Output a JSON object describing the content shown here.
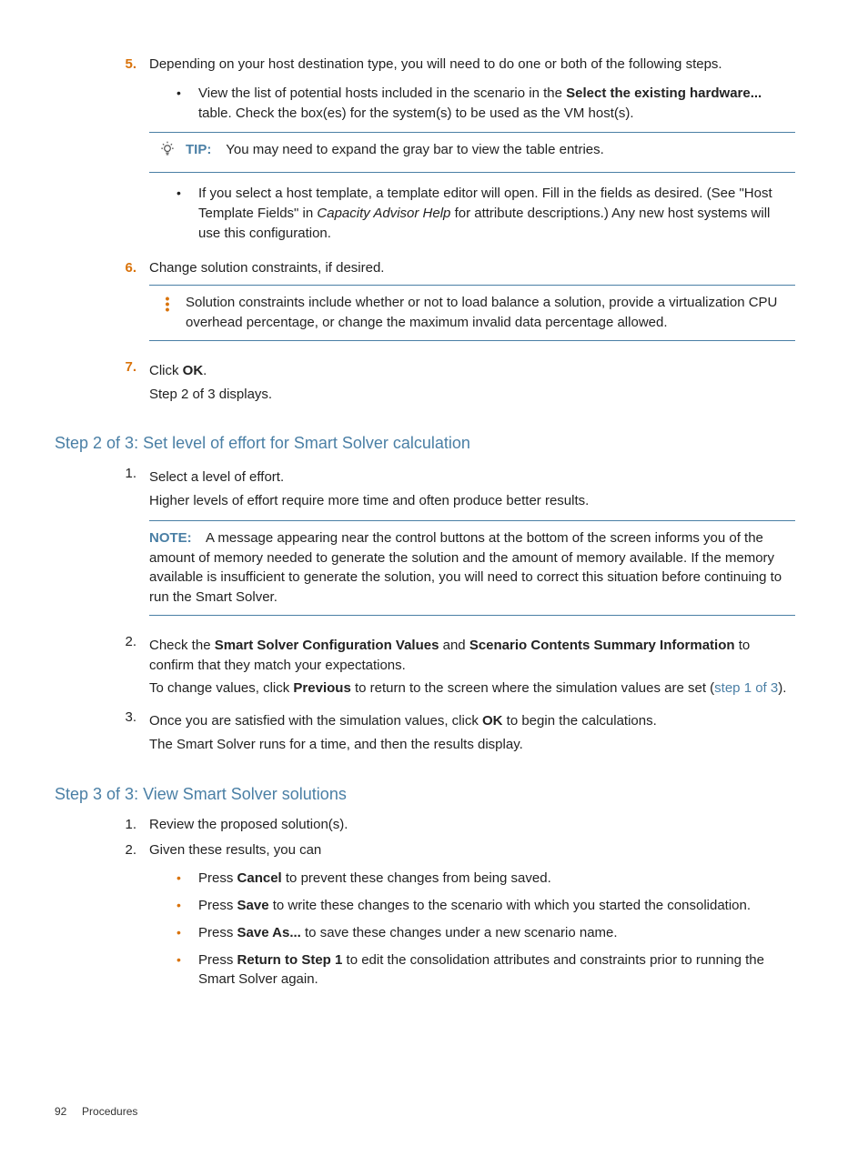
{
  "section1": {
    "item5": {
      "num": "5.",
      "text": "Depending on your host destination type, you will need to do one or both of the following steps.",
      "bullet1a": "View the list of potential hosts included in the scenario in the ",
      "bullet1b": "Select the existing hardware...",
      "bullet1c": " table. Check the box(es) for the system(s) to be used as the VM host(s).",
      "tipLabel": "TIP:",
      "tipText": "You may need to expand the gray bar to view the table entries.",
      "bullet2a": "If you select a host template, a template editor will open. Fill in the fields as desired. (See \"Host Template Fields\" in ",
      "bullet2b": "Capacity Advisor Help",
      "bullet2c": " for attribute descriptions.) Any new host systems will use this configuration."
    },
    "item6": {
      "num": "6.",
      "text": "Change solution constraints, if desired.",
      "noteText": "Solution constraints include whether or not to load balance a solution, provide a virtualization CPU overhead percentage, or change the maximum invalid data percentage allowed."
    },
    "item7": {
      "num": "7.",
      "textA": "Click ",
      "textB": "OK",
      "textC": ".",
      "sub": "Step 2 of 3 displays."
    }
  },
  "heading2": "Step 2 of 3: Set level of effort for Smart Solver calculation",
  "section2": {
    "item1": {
      "num": "1.",
      "text": "Select a level of effort.",
      "sub": "Higher levels of effort require more time and often produce better results.",
      "noteLabel": "NOTE:",
      "noteText": "A message appearing near the control buttons at the bottom of the screen informs you of the amount of memory needed to generate the solution and the amount of memory available. If the memory available is insufficient to generate the solution, you will need to correct this situation before continuing to run the Smart Solver."
    },
    "item2": {
      "num": "2.",
      "a": "Check the ",
      "b": "Smart Solver Configuration Values",
      "c": " and ",
      "d": "Scenario Contents Summary Information",
      "e": " to confirm that they match your expectations.",
      "subA": "To change values, click ",
      "subB": "Previous",
      "subC": " to return to the screen where the simulation values are set (",
      "subD": "step 1 of 3",
      "subE": ")."
    },
    "item3": {
      "num": "3.",
      "a": "Once you are satisfied with the simulation values, click ",
      "b": "OK",
      "c": " to begin the calculations.",
      "sub": "The Smart Solver runs for a time, and then the results display."
    }
  },
  "heading3": "Step 3 of 3: View Smart Solver solutions",
  "section3": {
    "item1": {
      "num": "1.",
      "text": "Review the proposed solution(s)."
    },
    "item2": {
      "num": "2.",
      "text": "Given these results, you can",
      "b1a": "Press ",
      "b1b": "Cancel",
      "b1c": " to prevent these changes from being saved.",
      "b2a": "Press ",
      "b2b": "Save",
      "b2c": " to write these changes to the scenario with which you started the consolidation.",
      "b3a": "Press ",
      "b3b": "Save As...",
      "b3c": " to save these changes under a new scenario name.",
      "b4a": "Press ",
      "b4b": "Return to Step 1",
      "b4c": " to edit the consolidation attributes and constraints prior to running the Smart Solver again."
    }
  },
  "footer": {
    "page": "92",
    "label": "Procedures"
  }
}
